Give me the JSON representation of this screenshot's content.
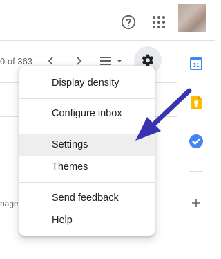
{
  "header": {
    "help_icon": "help-circle-icon",
    "apps_icon": "apps-grid-icon",
    "avatar": "user-avatar"
  },
  "toolbar": {
    "pager_text": "0 of 363",
    "prev_icon": "chevron-left-icon",
    "next_icon": "chevron-right-icon",
    "density_icon": "density-lines-icon",
    "settings_icon": "gear-icon"
  },
  "background": {
    "partial_text": "nage"
  },
  "side_panel": {
    "icons": [
      "calendar-icon",
      "keep-icon",
      "tasks-icon",
      "add-icon"
    ],
    "calendar_day": "31",
    "colors": {
      "calendar": "#4285f4",
      "keep": "#fbbc04",
      "tasks": "#4285f4"
    }
  },
  "menu": {
    "items": [
      {
        "label": "Display density"
      },
      {
        "label": "Configure inbox"
      },
      {
        "label": "Settings",
        "highlighted": true
      },
      {
        "label": "Themes"
      },
      {
        "label": "Send feedback"
      },
      {
        "label": "Help"
      }
    ]
  },
  "annotation": {
    "arrow_color": "#3834b0"
  }
}
